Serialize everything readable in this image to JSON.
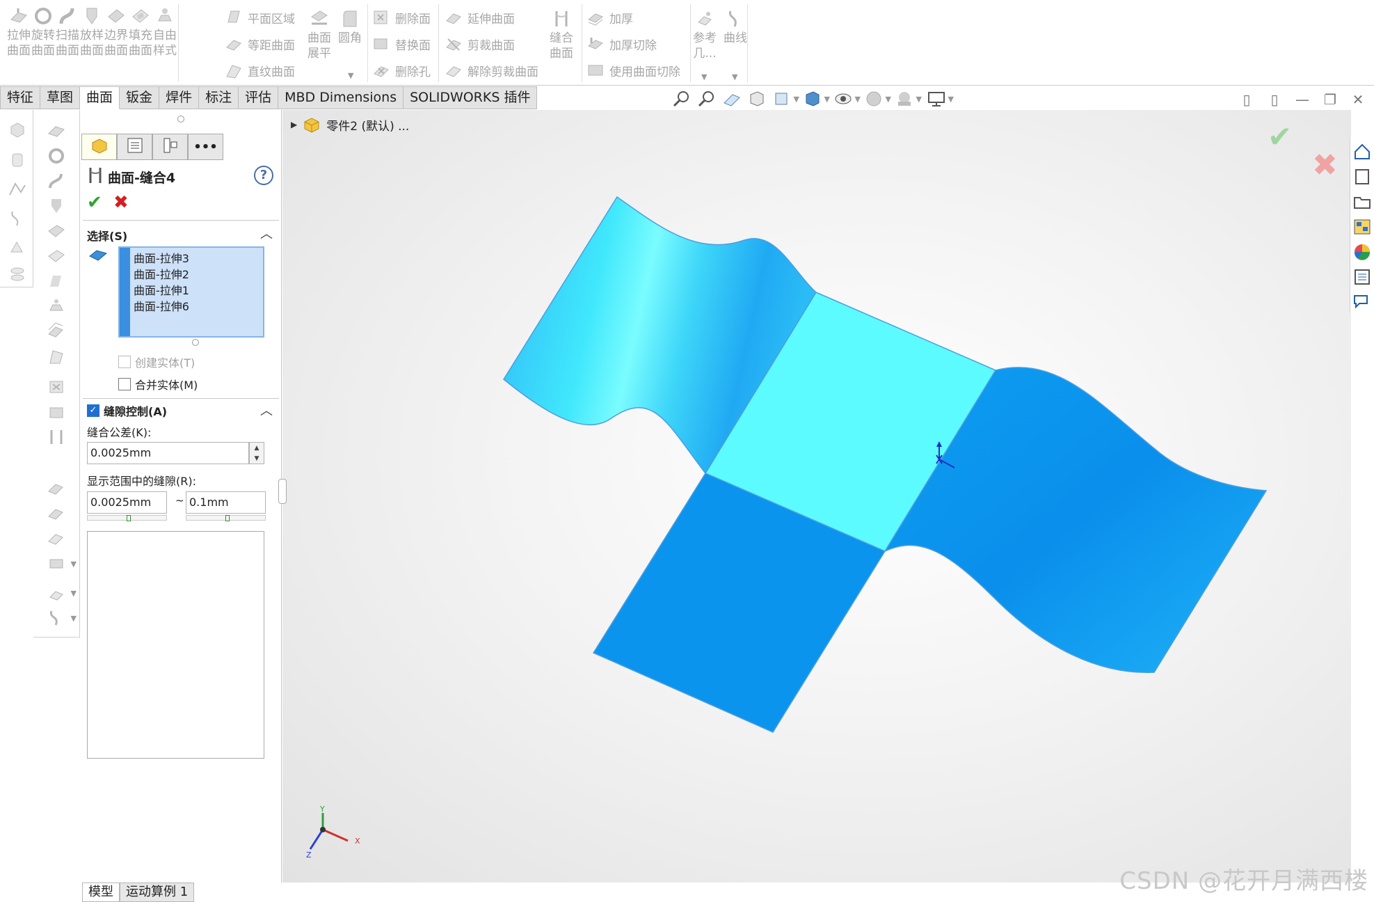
{
  "ribbon": {
    "big_buttons": [
      {
        "label": "拉伸\n曲面",
        "icon": "extruded-surface-icon"
      },
      {
        "label": "旋转\n曲面",
        "icon": "revolved-surface-icon"
      },
      {
        "label": "扫描\n曲面",
        "icon": "swept-surface-icon"
      },
      {
        "label": "放样\n曲面",
        "icon": "lofted-surface-icon"
      },
      {
        "label": "边界\n曲面",
        "icon": "boundary-surface-icon"
      },
      {
        "label": "填充\n曲面",
        "icon": "filled-surface-icon"
      },
      {
        "label": "自由\n样式",
        "icon": "freeform-icon"
      }
    ],
    "col2": [
      "平面区域",
      "等距曲面",
      "直纹曲面"
    ],
    "flatten_label": "曲面\n展平",
    "fillet_label": "圆角",
    "col3": [
      "删除面",
      "替换面",
      "删除孔"
    ],
    "col4": [
      "延伸曲面",
      "剪裁曲面",
      "解除剪裁曲面"
    ],
    "knit_label": "缝合\n曲面",
    "col5": [
      "加厚",
      "加厚切除",
      "使用曲面切除"
    ],
    "ref_geom_label": "参考\n几...",
    "curves_label": "曲线"
  },
  "tabs": [
    {
      "label": "特征",
      "active": false
    },
    {
      "label": "草图",
      "active": false
    },
    {
      "label": "曲面",
      "active": true
    },
    {
      "label": "钣金",
      "active": false
    },
    {
      "label": "焊件",
      "active": false
    },
    {
      "label": "标注",
      "active": false
    },
    {
      "label": "评估",
      "active": false
    },
    {
      "label": "MBD Dimensions",
      "active": false
    },
    {
      "label": "SOLIDWORKS 插件",
      "active": false
    }
  ],
  "property_manager": {
    "title": "曲面-缝合4",
    "selections_header": "选择(S)",
    "selected_items": [
      "曲面-拉伸3",
      "曲面-拉伸2",
      "曲面-拉伸1",
      "曲面-拉伸6"
    ],
    "create_solid_label": "创建实体(T)",
    "merge_entities_label": "合并实体(M)",
    "gap_control_header": "缝隙控制(A)",
    "gap_control_checked": true,
    "knit_tolerance_label": "缝合公差(K):",
    "knit_tolerance_value": "0.0025mm",
    "gap_range_label": "显示范围中的缝隙(R):",
    "gap_range_min": "0.0025mm",
    "gap_range_separator": "~",
    "gap_range_max": "0.1mm",
    "gap_range_min_level": 0.52,
    "gap_range_max_level": 0.52
  },
  "tree": {
    "part_label": "零件2 (默认) ..."
  },
  "axis_labels": {
    "x": "X",
    "y": "Y",
    "z": "Z"
  },
  "bottom_tabs": [
    {
      "label": "模型",
      "active": true
    },
    {
      "label": "运动算例 1",
      "active": false
    }
  ],
  "watermark": "CSDN @花开月满西楼",
  "colors": {
    "surface_light": "#56f8ff",
    "surface_mid": "#22c8f7",
    "surface_dark": "#0a92ee",
    "accent_blue": "#1f6fd1",
    "ok_green": "#2aa52a",
    "cancel_red": "#d21f1f"
  }
}
